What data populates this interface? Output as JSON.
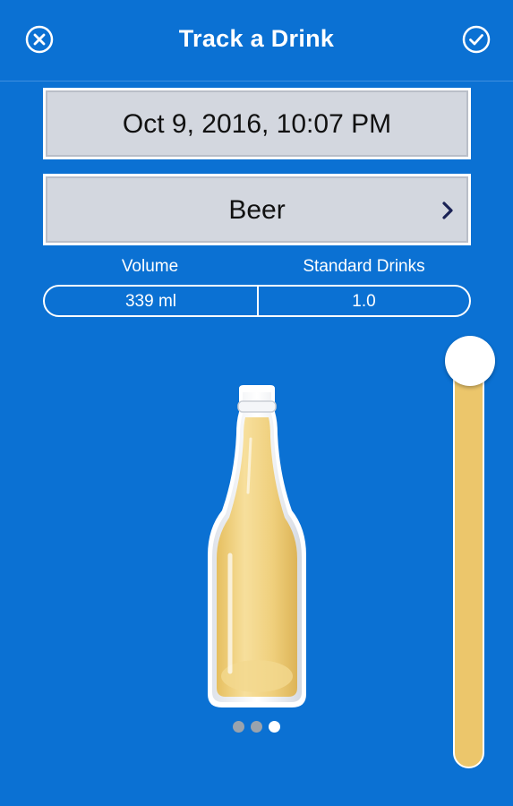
{
  "header": {
    "title": "Track a Drink",
    "close_icon": "close-circle-icon",
    "done_icon": "check-circle-icon"
  },
  "date_time": {
    "value": "Oct 9, 2016, 10:07 PM"
  },
  "drink_type": {
    "value": "Beer",
    "chevron_icon": "chevron-right-icon"
  },
  "stats": {
    "volume_label": "Volume",
    "standard_drinks_label": "Standard Drinks",
    "volume_value": "339 ml",
    "standard_drinks_value": "1.0"
  },
  "carousel": {
    "page_count": 3,
    "current_page": 3
  },
  "slider": {
    "level": 1.0
  },
  "colors": {
    "background": "#0b71d3",
    "field_background": "#d3d7df",
    "beer": "#ecc66b",
    "text_dark": "#111111",
    "white": "#ffffff"
  }
}
